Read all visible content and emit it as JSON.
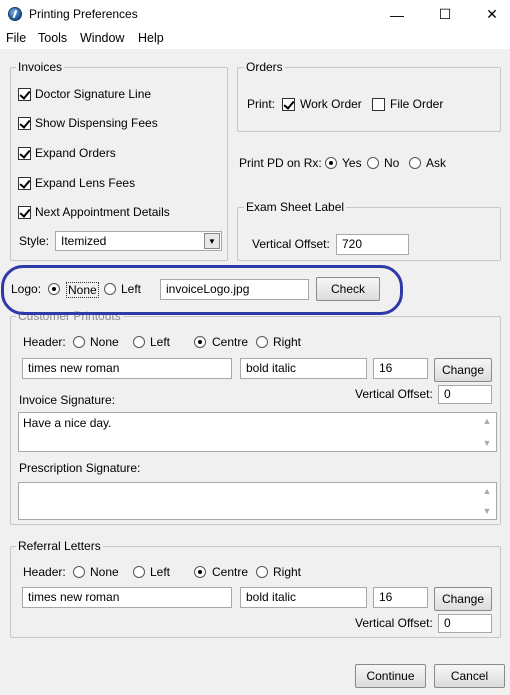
{
  "window": {
    "title": "Printing Preferences",
    "minimize": "—",
    "maximize": "☐",
    "close": "✕"
  },
  "menu": [
    "File",
    "Tools",
    "Window",
    "Help"
  ],
  "invoices": {
    "title": "Invoices",
    "checks": [
      {
        "label": "Doctor Signature Line",
        "checked": true
      },
      {
        "label": "Show Dispensing Fees",
        "checked": true
      },
      {
        "label": "Expand Orders",
        "checked": true
      },
      {
        "label": "Expand Lens Fees",
        "checked": true
      },
      {
        "label": "Next Appointment Details",
        "checked": true
      }
    ],
    "style_label": "Style:",
    "style_value": "Itemized"
  },
  "orders": {
    "title": "Orders",
    "print_label": "Print:",
    "work_order": "Work Order",
    "work_order_checked": true,
    "file_order": "File Order",
    "file_order_checked": false
  },
  "print_pd": {
    "label": "Print PD on Rx:",
    "options": [
      "Yes",
      "No",
      "Ask"
    ],
    "selected": "Yes"
  },
  "exam_sheet": {
    "title": "Exam Sheet Label",
    "offset_label": "Vertical Offset:",
    "offset_value": "720"
  },
  "logo": {
    "label": "Logo:",
    "options": [
      "None",
      "Left"
    ],
    "selected": "None",
    "file": "invoiceLogo.jpg",
    "check_button": "Check"
  },
  "customer_printouts": {
    "title": "Customer Printouts",
    "header_label": "Header:",
    "header_options": [
      "None",
      "Left",
      "Centre",
      "Right"
    ],
    "header_selected": "Centre",
    "font": "times new roman",
    "style": "bold italic",
    "size": "16",
    "change_button": "Change",
    "offset_label": "Vertical Offset:",
    "offset_value": "0",
    "invoice_sig_label": "Invoice Signature:",
    "invoice_sig_value": "Have a nice day.",
    "rx_sig_label": "Prescription Signature:",
    "rx_sig_value": ""
  },
  "referral": {
    "title": "Referral Letters",
    "header_label": "Header:",
    "header_options": [
      "None",
      "Left",
      "Centre",
      "Right"
    ],
    "header_selected": "Centre",
    "font": "times new roman",
    "style": "bold italic",
    "size": "16",
    "change_button": "Change",
    "offset_label": "Vertical Offset:",
    "offset_value": "0"
  },
  "footer": {
    "continue": "Continue",
    "cancel": "Cancel"
  },
  "colors": {
    "highlight": "#2f3aa8",
    "background": "#f0f0f0"
  }
}
